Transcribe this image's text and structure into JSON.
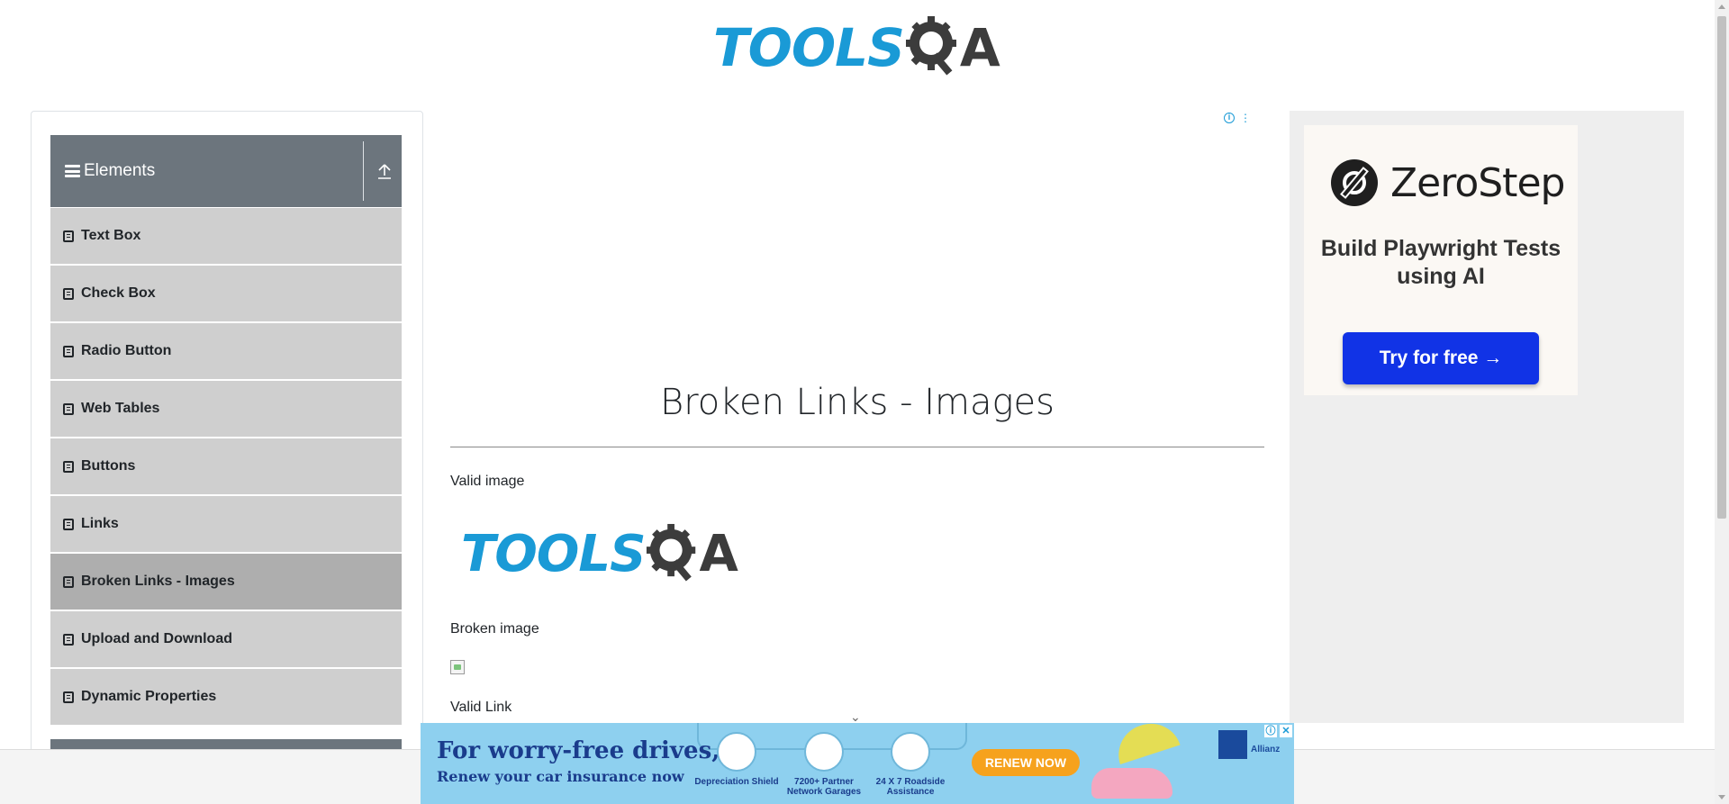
{
  "header": {
    "logo": "TOOLSQA"
  },
  "sidebar": {
    "group_title": "Elements",
    "items": [
      {
        "label": "Text Box"
      },
      {
        "label": "Check Box"
      },
      {
        "label": "Radio Button"
      },
      {
        "label": "Web Tables"
      },
      {
        "label": "Buttons"
      },
      {
        "label": "Links"
      },
      {
        "label": "Broken Links - Images",
        "active": true
      },
      {
        "label": "Upload and Download"
      },
      {
        "label": "Dynamic Properties"
      }
    ]
  },
  "main": {
    "title": "Broken Links - Images",
    "valid_image_label": "Valid image",
    "broken_image_label": "Broken image",
    "valid_link_label": "Valid Link"
  },
  "right_ad": {
    "brand": "ZeroStep",
    "tagline": "Build Playwright Tests using AI",
    "cta": "Try for free →"
  },
  "bottom_ad": {
    "headline": "For worry-free drives,",
    "subline": "Renew your car insurance now",
    "features": [
      "Depreciation Shield",
      "7200+ Partner Network Garages",
      "24 X 7 Roadside Assistance"
    ],
    "cta": "RENEW NOW",
    "sponsor": "Allianz"
  },
  "colors": {
    "brand_blue": "#1a9ad6",
    "sidebar_header": "#6c757d",
    "menu_item": "#cfcfcf",
    "menu_active": "#aeaeae"
  }
}
